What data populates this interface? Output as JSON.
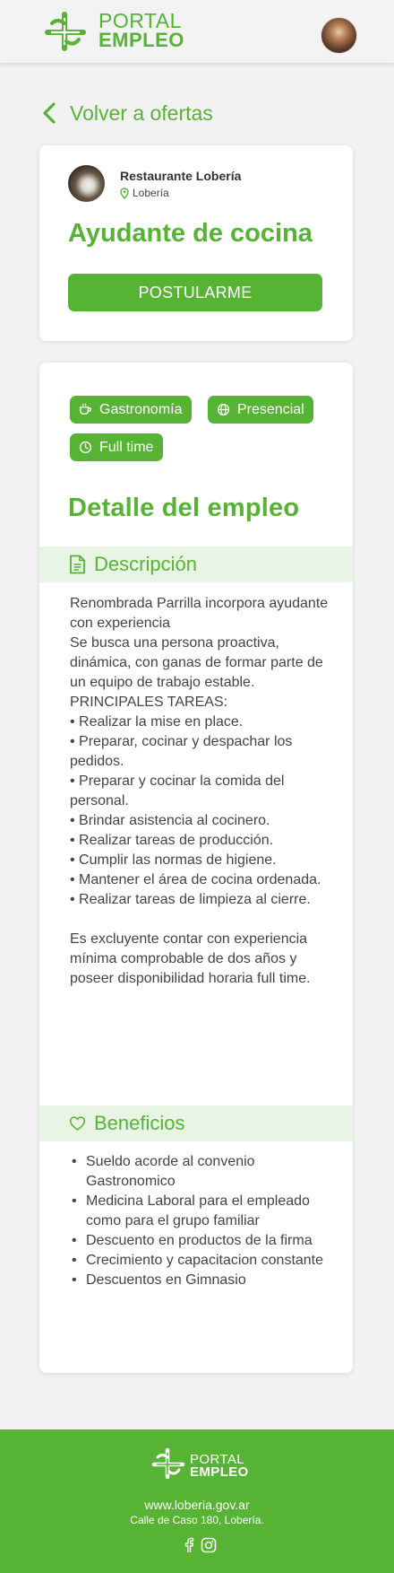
{
  "header": {
    "logo_line1": "PORTAL",
    "logo_line2": "EMPLEO"
  },
  "back_link": {
    "label": "Volver a ofertas"
  },
  "job": {
    "company": "Restaurante Lobería",
    "location": "Lobería",
    "title": "Ayudante de cocina",
    "apply_label": "POSTULARME"
  },
  "tags": [
    {
      "label": "Gastronomía",
      "icon": "coffee-cup-icon"
    },
    {
      "label": "Presencial",
      "icon": "globe-icon"
    },
    {
      "label": "Full time",
      "icon": "clock-icon"
    }
  ],
  "detail": {
    "title": "Detalle del empleo",
    "description_heading": "Descripción",
    "description_lines": [
      "Renombrada Parrilla incorpora ayudante con experiencia",
      "Se busca una persona proactiva, dinámica, con ganas de formar parte de un equipo de trabajo estable.",
      "PRINCIPALES TAREAS:",
      "•  Realizar la mise en place.",
      "•  Preparar, cocinar y despachar los pedidos.",
      "• Preparar y cocinar la comida del personal.",
      "• Brindar asistencia al cocinero.",
      "• Realizar tareas de producción.",
      "• Cumplir las normas de higiene.",
      "• Mantener el área de cocina ordenada.",
      "• Realizar tareas de limpieza al cierre."
    ],
    "description_requirement": "Es excluyente contar con experiencia mínima comprobable de dos años y poseer disponibilidad horaria full time.",
    "benefits_heading": "Beneficios",
    "benefits": [
      "Sueldo acorde al convenio Gastronomico",
      "Medicina Laboral para el empleado como para el grupo familiar",
      "Descuento en productos de la firma",
      "Crecimiento y capacitacion constante",
      "Descuentos en Gimnasio"
    ]
  },
  "footer": {
    "logo_line1": "PORTAL",
    "logo_line2": "EMPLEO",
    "url": "www.loberia.gov.ar",
    "address": "Calle de Caso 180, Lobería."
  },
  "colors": {
    "brand_green": "#56b334",
    "section_bg": "#e9f5e4",
    "page_bg": "#f2f2f2"
  }
}
